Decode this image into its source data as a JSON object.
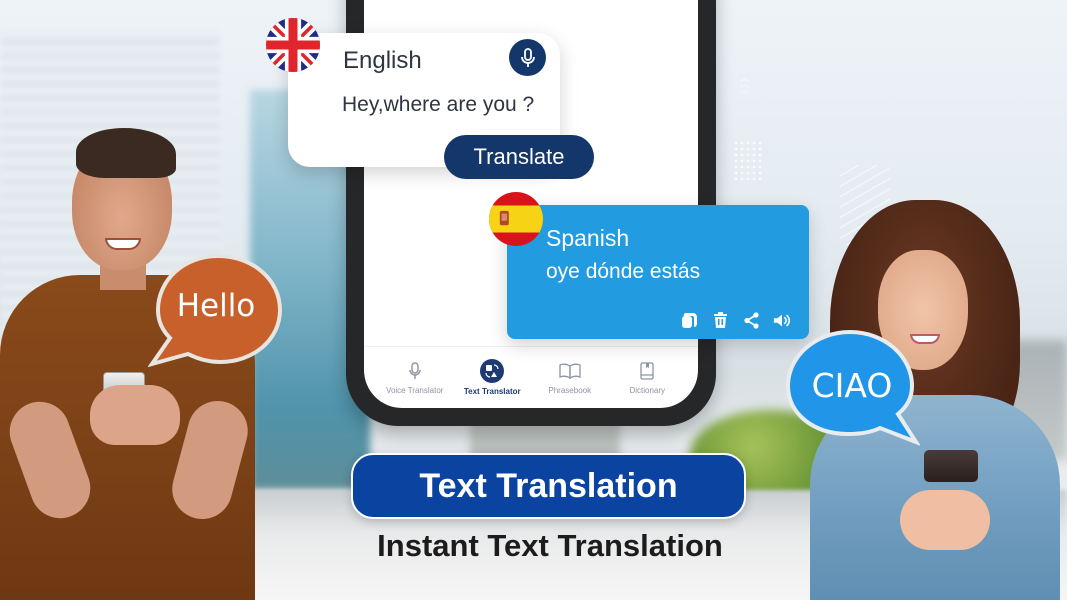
{
  "app": {
    "accent_dark": "#14376b",
    "accent_light": "#239be0",
    "headline_blue": "#0b44a0"
  },
  "source_card": {
    "language": "English",
    "flag": "uk-flag-icon",
    "text": "Hey,where are you ?",
    "mic_icon": "microphone-icon",
    "translate_label": "Translate"
  },
  "target_card": {
    "language": "Spanish",
    "flag": "spain-flag-icon",
    "text": "oye dónde estás",
    "actions": [
      {
        "name": "copy",
        "icon": "copy-icon"
      },
      {
        "name": "delete",
        "icon": "trash-icon"
      },
      {
        "name": "share",
        "icon": "share-icon"
      },
      {
        "name": "speak",
        "icon": "speaker-icon"
      }
    ]
  },
  "bottom_nav": {
    "items": [
      {
        "label": "Voice Translator",
        "icon": "microphone-icon",
        "active": false
      },
      {
        "label": "Text Translator",
        "icon": "translate-icon",
        "active": true
      },
      {
        "label": "Phrasebook",
        "icon": "open-book-icon",
        "active": false
      },
      {
        "label": "Dictionary",
        "icon": "dictionary-icon",
        "active": false
      }
    ]
  },
  "bubbles": {
    "left": {
      "text": "Hello",
      "color": "#c8602b"
    },
    "right": {
      "text": "CIAO",
      "color": "#2196e8"
    }
  },
  "headline": {
    "title": "Text Translation",
    "subtitle": "Instant Text Translation"
  }
}
